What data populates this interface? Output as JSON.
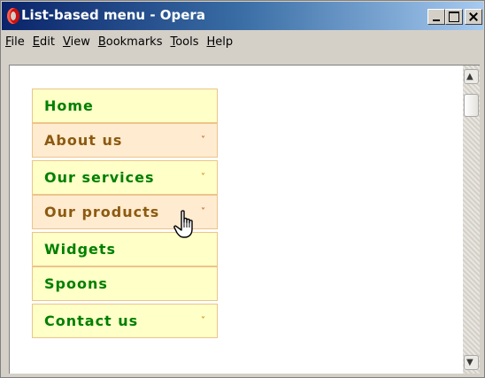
{
  "window": {
    "title": "List-based menu - Opera",
    "icon": "opera-icon",
    "controls": [
      "minimize-icon",
      "maximize-icon",
      "close-icon"
    ]
  },
  "menubar": {
    "items": [
      {
        "key": "F",
        "rest": "ile"
      },
      {
        "key": "E",
        "rest": "dit"
      },
      {
        "key": "V",
        "rest": "iew"
      },
      {
        "key": "B",
        "rest": "ookmarks"
      },
      {
        "key": "T",
        "rest": "ools"
      },
      {
        "key": "H",
        "rest": "elp"
      }
    ]
  },
  "nav": {
    "items": [
      {
        "label": "Home",
        "arrow": ""
      },
      {
        "label": "About us",
        "arrow": "˅"
      },
      {
        "label": "Our services",
        "arrow": "˅"
      },
      {
        "label": "Our products",
        "arrow": "˅"
      },
      {
        "label": "Widgets",
        "arrow": ""
      },
      {
        "label": "Spoons",
        "arrow": ""
      },
      {
        "label": "Contact us",
        "arrow": "˅"
      }
    ]
  },
  "colors": {
    "item_green_bg": "#ffffc8",
    "item_green_text": "#008000",
    "item_brown_bg": "#ffebd0",
    "item_brown_text": "#8c5a10",
    "item_border": "#ecc48a"
  },
  "cursor": "hand-pointer-icon"
}
